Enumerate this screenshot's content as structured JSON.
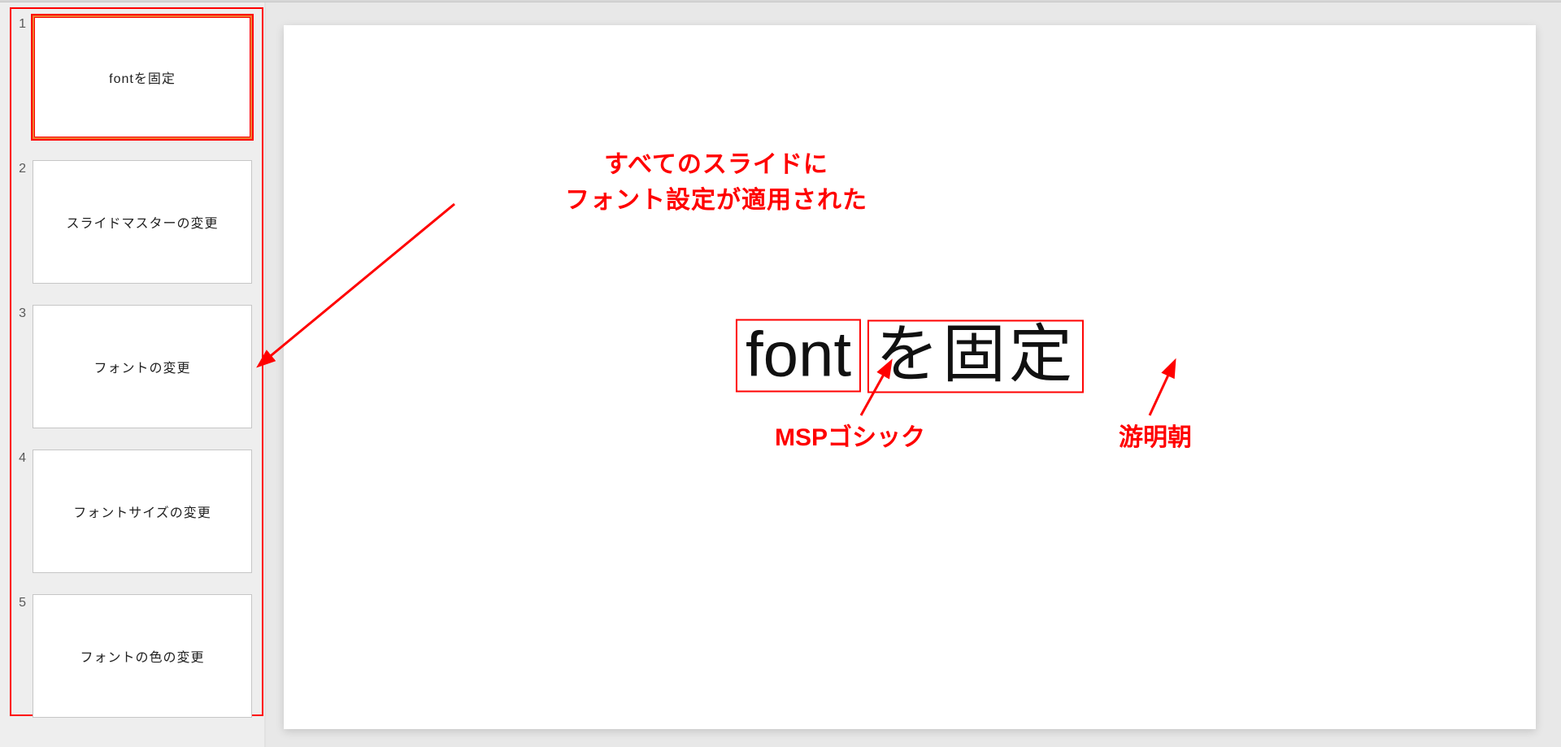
{
  "sidebar": {
    "thumbs": [
      {
        "num": "1",
        "title": "fontを固定",
        "cls": "gothic",
        "selected": true
      },
      {
        "num": "2",
        "title": "スライドマスターの変更",
        "cls": "",
        "selected": false
      },
      {
        "num": "3",
        "title": "フォントの変更",
        "cls": "",
        "selected": false
      },
      {
        "num": "4",
        "title": "フォントサイズの変更",
        "cls": "",
        "selected": false
      },
      {
        "num": "5",
        "title": "フォントの色の変更",
        "cls": "",
        "selected": false
      }
    ]
  },
  "slide": {
    "title_eng": "font",
    "title_jp": "を固定"
  },
  "annotations": {
    "top_line1": "すべてのスライドに",
    "top_line2": "フォント設定が適用された",
    "msp": "MSPゴシック",
    "yumin": "游明朝"
  }
}
